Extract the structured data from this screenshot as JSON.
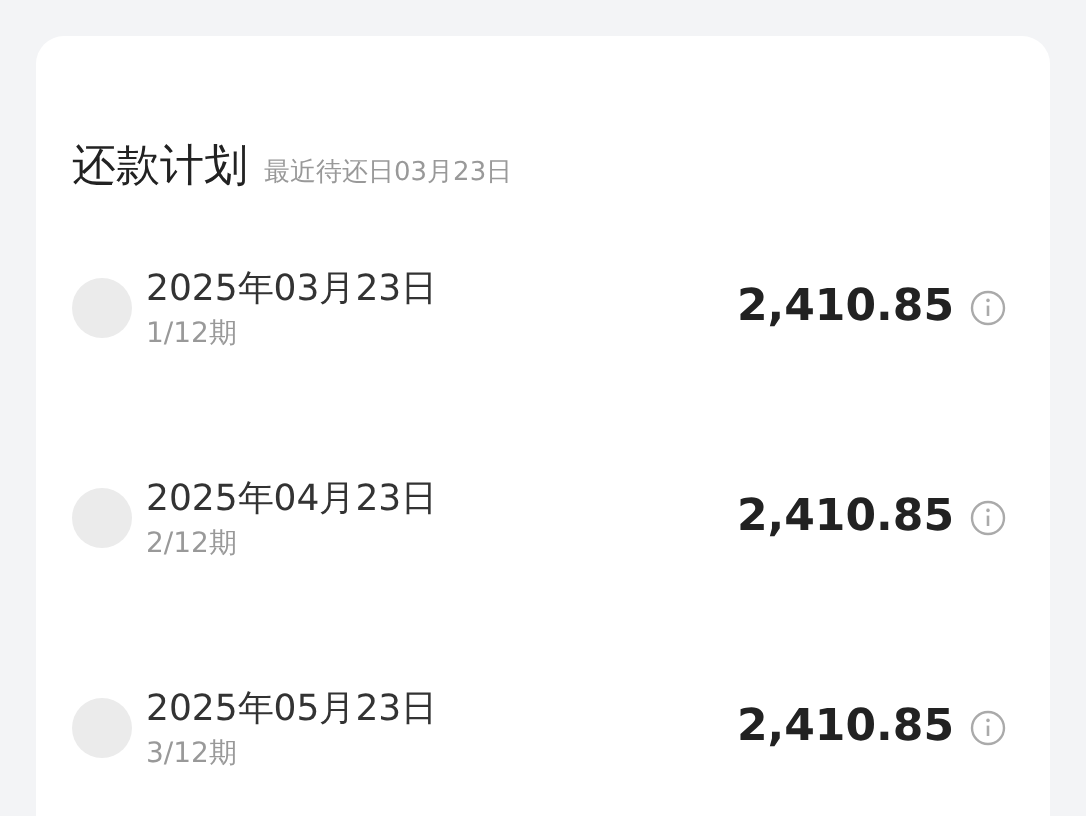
{
  "plan": {
    "title": "还款计划",
    "subtitle": "最近待还日03月23日",
    "rows": [
      {
        "date": "2025年03月23日",
        "period": "1/12期",
        "amount": "2,410.85"
      },
      {
        "date": "2025年04月23日",
        "period": "2/12期",
        "amount": "2,410.85"
      },
      {
        "date": "2025年05月23日",
        "period": "3/12期",
        "amount": "2,410.85"
      }
    ]
  }
}
